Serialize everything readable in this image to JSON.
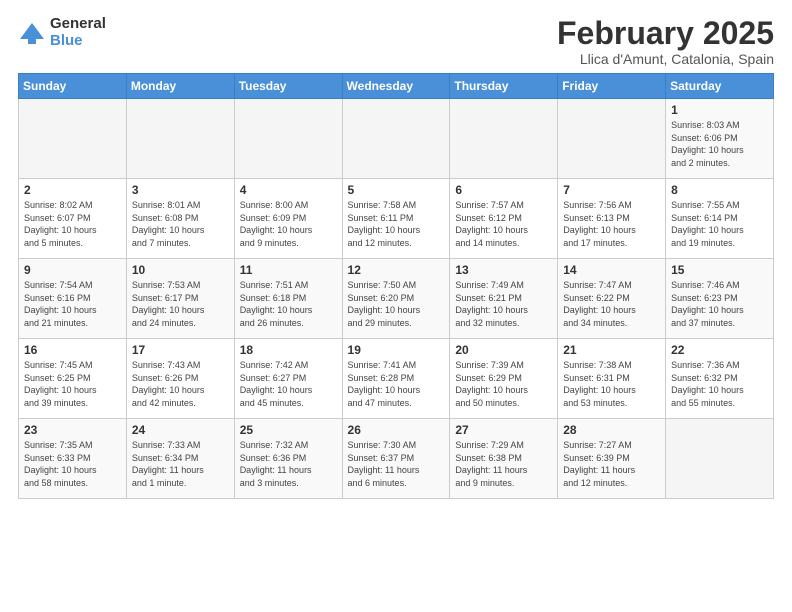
{
  "logo": {
    "general": "General",
    "blue": "Blue"
  },
  "title": "February 2025",
  "subtitle": "Llica d'Amunt, Catalonia, Spain",
  "weekdays": [
    "Sunday",
    "Monday",
    "Tuesday",
    "Wednesday",
    "Thursday",
    "Friday",
    "Saturday"
  ],
  "weeks": [
    [
      {
        "day": "",
        "info": ""
      },
      {
        "day": "",
        "info": ""
      },
      {
        "day": "",
        "info": ""
      },
      {
        "day": "",
        "info": ""
      },
      {
        "day": "",
        "info": ""
      },
      {
        "day": "",
        "info": ""
      },
      {
        "day": "1",
        "info": "Sunrise: 8:03 AM\nSunset: 6:06 PM\nDaylight: 10 hours\nand 2 minutes."
      }
    ],
    [
      {
        "day": "2",
        "info": "Sunrise: 8:02 AM\nSunset: 6:07 PM\nDaylight: 10 hours\nand 5 minutes."
      },
      {
        "day": "3",
        "info": "Sunrise: 8:01 AM\nSunset: 6:08 PM\nDaylight: 10 hours\nand 7 minutes."
      },
      {
        "day": "4",
        "info": "Sunrise: 8:00 AM\nSunset: 6:09 PM\nDaylight: 10 hours\nand 9 minutes."
      },
      {
        "day": "5",
        "info": "Sunrise: 7:58 AM\nSunset: 6:11 PM\nDaylight: 10 hours\nand 12 minutes."
      },
      {
        "day": "6",
        "info": "Sunrise: 7:57 AM\nSunset: 6:12 PM\nDaylight: 10 hours\nand 14 minutes."
      },
      {
        "day": "7",
        "info": "Sunrise: 7:56 AM\nSunset: 6:13 PM\nDaylight: 10 hours\nand 17 minutes."
      },
      {
        "day": "8",
        "info": "Sunrise: 7:55 AM\nSunset: 6:14 PM\nDaylight: 10 hours\nand 19 minutes."
      }
    ],
    [
      {
        "day": "9",
        "info": "Sunrise: 7:54 AM\nSunset: 6:16 PM\nDaylight: 10 hours\nand 21 minutes."
      },
      {
        "day": "10",
        "info": "Sunrise: 7:53 AM\nSunset: 6:17 PM\nDaylight: 10 hours\nand 24 minutes."
      },
      {
        "day": "11",
        "info": "Sunrise: 7:51 AM\nSunset: 6:18 PM\nDaylight: 10 hours\nand 26 minutes."
      },
      {
        "day": "12",
        "info": "Sunrise: 7:50 AM\nSunset: 6:20 PM\nDaylight: 10 hours\nand 29 minutes."
      },
      {
        "day": "13",
        "info": "Sunrise: 7:49 AM\nSunset: 6:21 PM\nDaylight: 10 hours\nand 32 minutes."
      },
      {
        "day": "14",
        "info": "Sunrise: 7:47 AM\nSunset: 6:22 PM\nDaylight: 10 hours\nand 34 minutes."
      },
      {
        "day": "15",
        "info": "Sunrise: 7:46 AM\nSunset: 6:23 PM\nDaylight: 10 hours\nand 37 minutes."
      }
    ],
    [
      {
        "day": "16",
        "info": "Sunrise: 7:45 AM\nSunset: 6:25 PM\nDaylight: 10 hours\nand 39 minutes."
      },
      {
        "day": "17",
        "info": "Sunrise: 7:43 AM\nSunset: 6:26 PM\nDaylight: 10 hours\nand 42 minutes."
      },
      {
        "day": "18",
        "info": "Sunrise: 7:42 AM\nSunset: 6:27 PM\nDaylight: 10 hours\nand 45 minutes."
      },
      {
        "day": "19",
        "info": "Sunrise: 7:41 AM\nSunset: 6:28 PM\nDaylight: 10 hours\nand 47 minutes."
      },
      {
        "day": "20",
        "info": "Sunrise: 7:39 AM\nSunset: 6:29 PM\nDaylight: 10 hours\nand 50 minutes."
      },
      {
        "day": "21",
        "info": "Sunrise: 7:38 AM\nSunset: 6:31 PM\nDaylight: 10 hours\nand 53 minutes."
      },
      {
        "day": "22",
        "info": "Sunrise: 7:36 AM\nSunset: 6:32 PM\nDaylight: 10 hours\nand 55 minutes."
      }
    ],
    [
      {
        "day": "23",
        "info": "Sunrise: 7:35 AM\nSunset: 6:33 PM\nDaylight: 10 hours\nand 58 minutes."
      },
      {
        "day": "24",
        "info": "Sunrise: 7:33 AM\nSunset: 6:34 PM\nDaylight: 11 hours\nand 1 minute."
      },
      {
        "day": "25",
        "info": "Sunrise: 7:32 AM\nSunset: 6:36 PM\nDaylight: 11 hours\nand 3 minutes."
      },
      {
        "day": "26",
        "info": "Sunrise: 7:30 AM\nSunset: 6:37 PM\nDaylight: 11 hours\nand 6 minutes."
      },
      {
        "day": "27",
        "info": "Sunrise: 7:29 AM\nSunset: 6:38 PM\nDaylight: 11 hours\nand 9 minutes."
      },
      {
        "day": "28",
        "info": "Sunrise: 7:27 AM\nSunset: 6:39 PM\nDaylight: 11 hours\nand 12 minutes."
      },
      {
        "day": "",
        "info": ""
      }
    ]
  ]
}
